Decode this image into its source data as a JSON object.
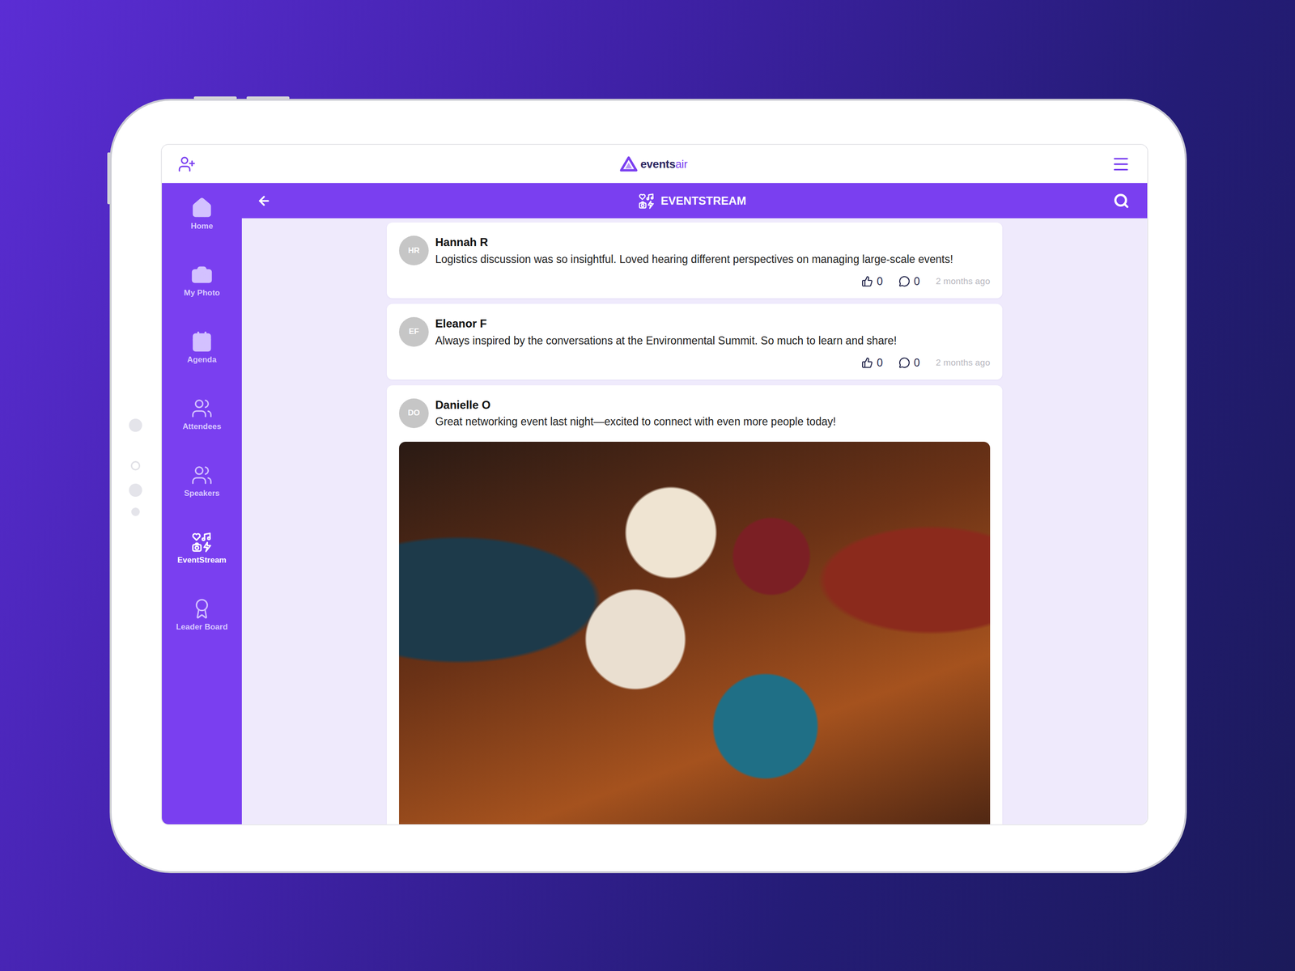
{
  "topbar": {
    "logo": {
      "bold": "events",
      "light": "air"
    }
  },
  "sidebar": {
    "items": [
      {
        "label": "Home",
        "selected": false
      },
      {
        "label": "My Photo",
        "selected": false
      },
      {
        "label": "Agenda",
        "selected": false
      },
      {
        "label": "Attendees",
        "selected": false
      },
      {
        "label": "Speakers",
        "selected": false
      },
      {
        "label": "EventStream",
        "selected": true
      },
      {
        "label": "Leader Board",
        "selected": false
      }
    ]
  },
  "header": {
    "title": "EVENTSTREAM"
  },
  "posts": [
    {
      "kind": "text",
      "initials": "HR",
      "author": "Hannah R",
      "text": "Logistics discussion was so insightful. Loved hearing different perspectives on managing large-scale events!",
      "likes": "0",
      "comments": "0",
      "time": "2 months ago"
    },
    {
      "kind": "text",
      "initials": "EF",
      "author": "Eleanor F",
      "text": "Always inspired by the conversations at the Environmental Summit. So much to learn and share!",
      "likes": "0",
      "comments": "0",
      "time": "2 months ago"
    },
    {
      "kind": "photo",
      "initials": "DO",
      "author": "Danielle O",
      "text": "Great networking event last night—excited to connect with even more people today!"
    }
  ]
}
